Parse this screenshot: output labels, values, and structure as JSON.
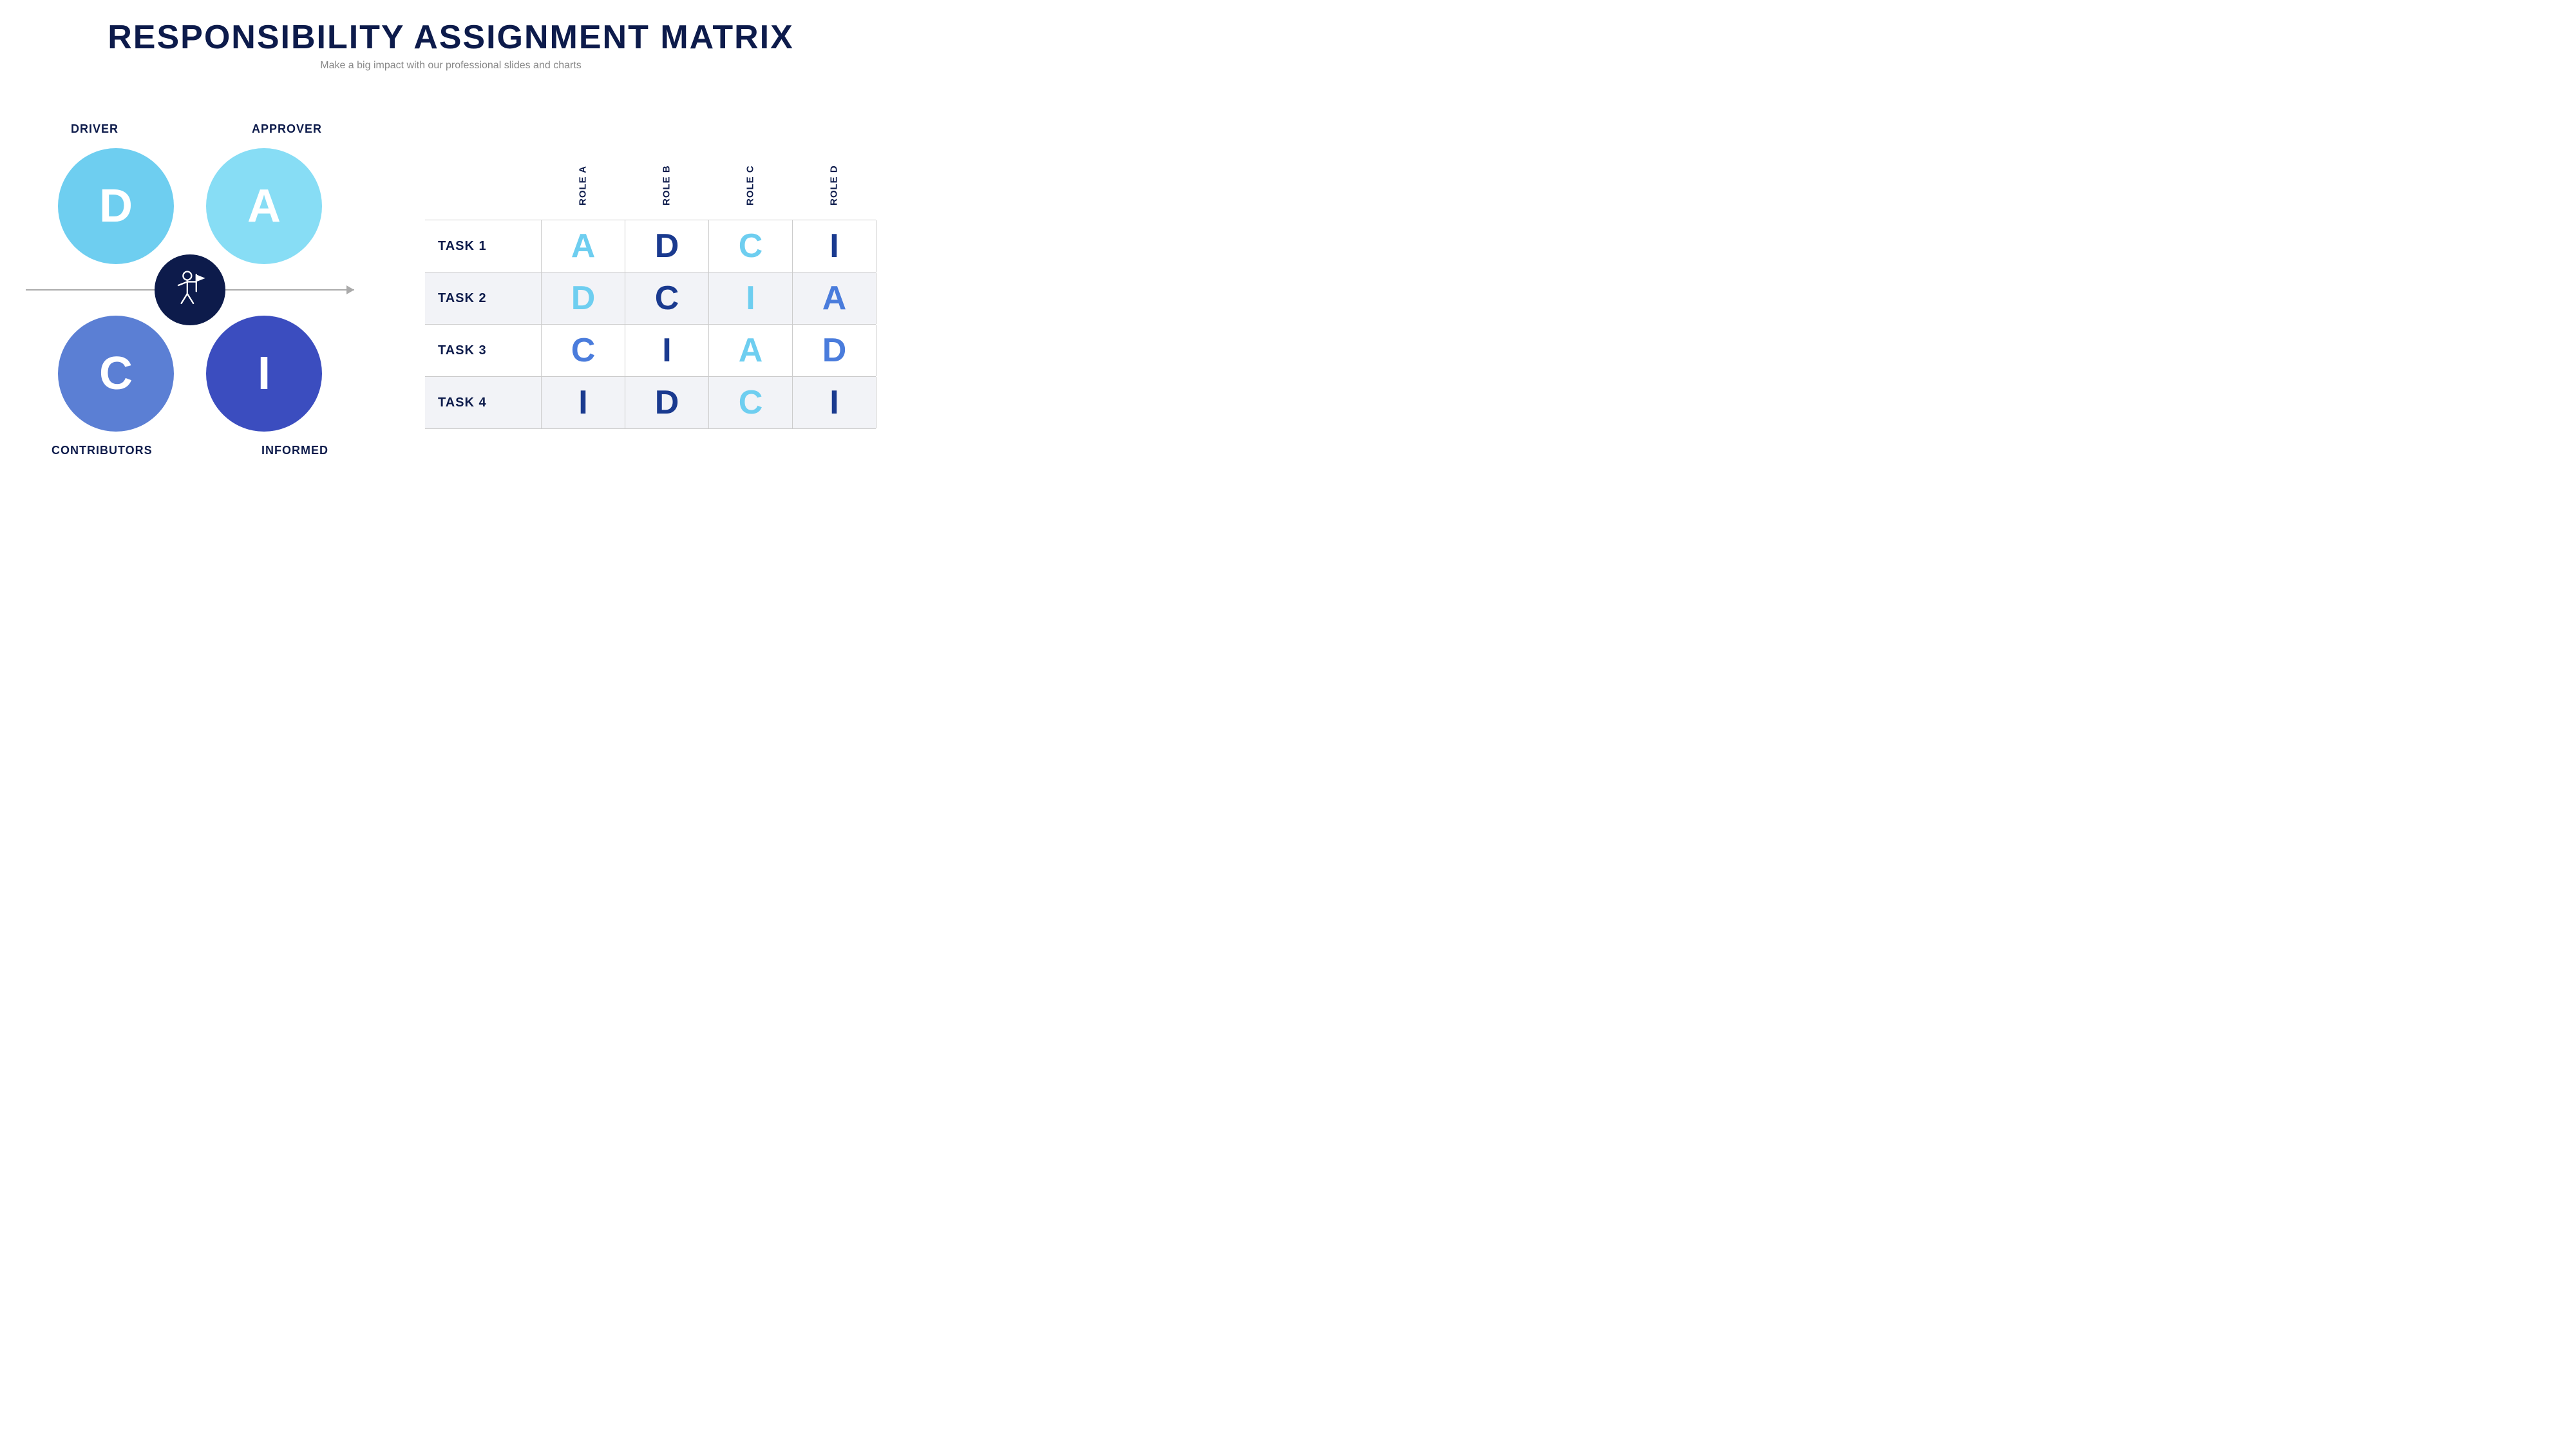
{
  "header": {
    "title": "RESPONSIBILITY ASSIGNMENT MATRIX",
    "subtitle": "Make a big impact with our professional slides and charts"
  },
  "diagram": {
    "labels": {
      "driver": "DRIVER",
      "approver": "APPROVER",
      "contributors": "CONTRIBUTORS",
      "informed": "INFORMED"
    },
    "circles": {
      "d": "D",
      "a": "A",
      "c": "C",
      "i": "I"
    }
  },
  "matrix": {
    "roles": [
      "ROLE A",
      "ROLE B",
      "ROLE C",
      "ROLE D"
    ],
    "rows": [
      {
        "task": "TASK 1",
        "shaded": false,
        "cells": [
          {
            "value": "A",
            "colorClass": "color-cyan"
          },
          {
            "value": "D",
            "colorClass": "color-navy"
          },
          {
            "value": "C",
            "colorClass": "color-cyan"
          },
          {
            "value": "I",
            "colorClass": "color-navy"
          }
        ]
      },
      {
        "task": "TASK 2",
        "shaded": true,
        "cells": [
          {
            "value": "D",
            "colorClass": "color-cyan"
          },
          {
            "value": "C",
            "colorClass": "color-navy"
          },
          {
            "value": "I",
            "colorClass": "color-cyan"
          },
          {
            "value": "A",
            "colorClass": "color-blue"
          }
        ]
      },
      {
        "task": "TASK 3",
        "shaded": false,
        "cells": [
          {
            "value": "C",
            "colorClass": "color-blue"
          },
          {
            "value": "I",
            "colorClass": "color-navy"
          },
          {
            "value": "A",
            "colorClass": "color-cyan"
          },
          {
            "value": "D",
            "colorClass": "color-blue"
          }
        ]
      },
      {
        "task": "TASK 4",
        "shaded": true,
        "cells": [
          {
            "value": "I",
            "colorClass": "color-navy"
          },
          {
            "value": "D",
            "colorClass": "color-navy"
          },
          {
            "value": "C",
            "colorClass": "color-cyan"
          },
          {
            "value": "I",
            "colorClass": "color-navy"
          }
        ]
      }
    ]
  }
}
